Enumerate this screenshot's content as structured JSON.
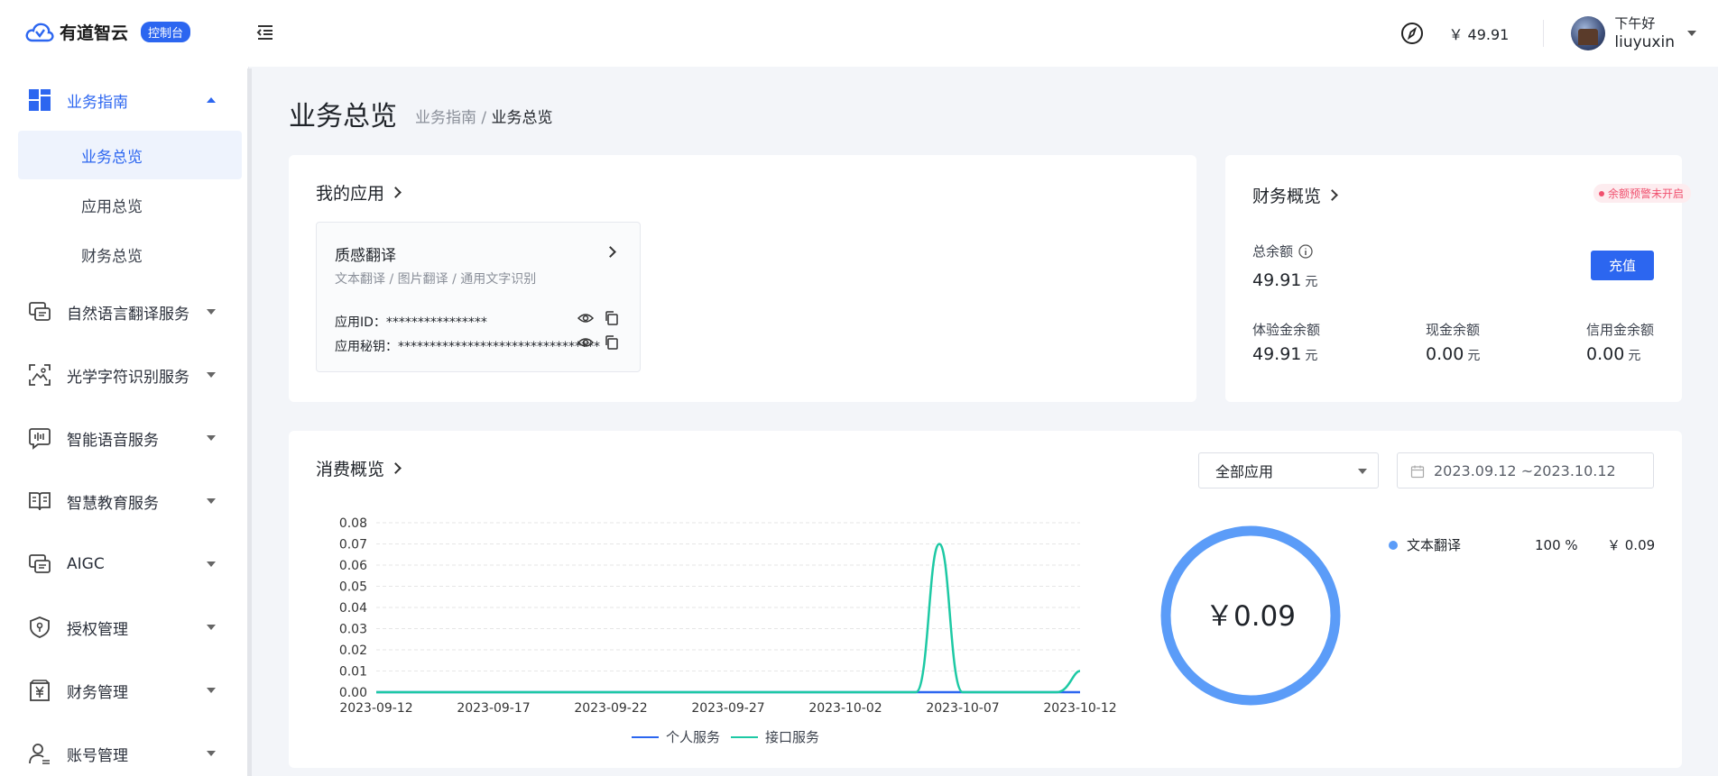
{
  "header": {
    "brand": "有道智云",
    "console_badge": "控制台",
    "balance": "￥ 49.91",
    "greeting": "下午好",
    "username": "liuyuxin"
  },
  "sidebar": {
    "groups": [
      {
        "label": "业务指南",
        "icon": "dashboard-icon",
        "expanded": true,
        "children": [
          {
            "label": "业务总览",
            "active": true
          },
          {
            "label": "应用总览"
          },
          {
            "label": "财务总览"
          }
        ]
      },
      {
        "label": "自然语言翻译服务",
        "icon": "translate-chat-icon"
      },
      {
        "label": "光学字符识别服务",
        "icon": "scan-image-icon"
      },
      {
        "label": "智能语音服务",
        "icon": "voice-wave-icon"
      },
      {
        "label": "智慧教育服务",
        "icon": "book-icon"
      },
      {
        "label": "AIGC",
        "icon": "aigc-chat-icon"
      },
      {
        "label": "授权管理",
        "icon": "shield-key-icon"
      },
      {
        "label": "财务管理",
        "icon": "yuan-box-icon"
      },
      {
        "label": "账号管理",
        "icon": "user-icon"
      }
    ]
  },
  "page": {
    "title": "业务总览",
    "breadcrumb_parent": "业务指南",
    "breadcrumb_sep": " / ",
    "breadcrumb_current": "业务总览"
  },
  "apps": {
    "title": "我的应用",
    "items": [
      {
        "name": "质感翻译",
        "desc": "文本翻译 / 图片翻译 / 通用文字识别",
        "id_label": "应用ID：",
        "id_value": "****************",
        "secret_label": "应用秘钥：",
        "secret_value": "********************************"
      }
    ]
  },
  "finance": {
    "title": "财务概览",
    "warning": "余额预警未开启",
    "total_label": "总余额",
    "total_value": "49.91",
    "unit": "元",
    "recharge": "充值",
    "trial_label": "体验金余额",
    "trial_value": "49.91",
    "cash_label": "现金余额",
    "cash_value": "0.00",
    "credit_label": "信用金余额",
    "credit_value": "0.00"
  },
  "consumption": {
    "title": "消费概览",
    "app_select": "全部应用",
    "date_range": "2023.09.12 ~2023.10.12",
    "total": "￥0.09",
    "breakdown": [
      {
        "name": "文本翻译",
        "percent": "100 %",
        "amount": "￥ 0.09",
        "color": "#5b9cf8"
      }
    ]
  },
  "chart_data": {
    "type": "line",
    "x_ticks": [
      "2023-09-12",
      "2023-09-17",
      "2023-09-22",
      "2023-09-27",
      "2023-10-02",
      "2023-10-07",
      "2023-10-12"
    ],
    "y_ticks": [
      "0.08",
      "0.07",
      "0.06",
      "0.05",
      "0.04",
      "0.03",
      "0.02",
      "0.01",
      "0.00"
    ],
    "ylim": [
      0,
      0.08
    ],
    "grid": true,
    "legend_position": "bottom",
    "series": [
      {
        "name": "个人服务",
        "color": "#2c66f0",
        "points": [
          [
            "2023-09-12",
            0
          ],
          [
            "2023-10-12",
            0
          ]
        ]
      },
      {
        "name": "接口服务",
        "color": "#1dc9a4",
        "points": [
          [
            "2023-09-12",
            0
          ],
          [
            "2023-10-05",
            0
          ],
          [
            "2023-10-06",
            0.07
          ],
          [
            "2023-10-07",
            0
          ],
          [
            "2023-10-11",
            0
          ],
          [
            "2023-10-12",
            0.01
          ]
        ]
      }
    ]
  }
}
